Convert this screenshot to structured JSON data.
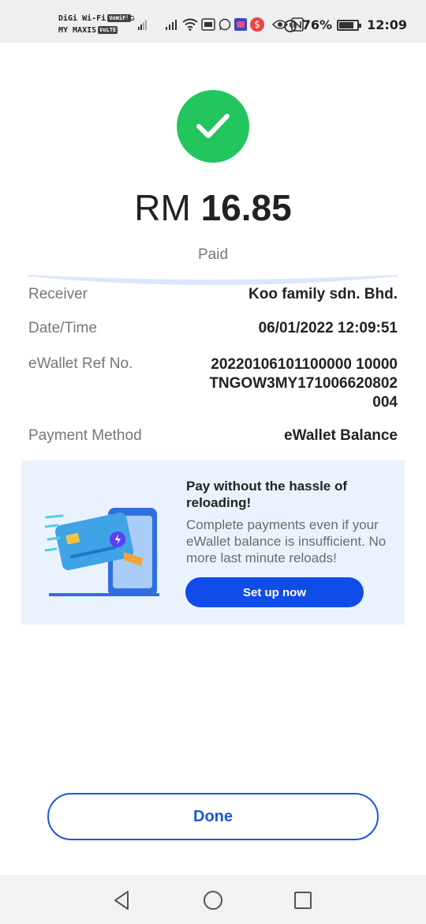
{
  "statusbar": {
    "carrier1": "DiGi Wi-Fi",
    "carrier1_tag": "VoWiFi",
    "carrier2": "MY MAXIS",
    "carrier2_tag": "VoLTE",
    "network": "4G",
    "battery_text": "76%",
    "battery_level": 0.76,
    "time": "12:09"
  },
  "payment": {
    "currency": "RM",
    "amount": "16.85",
    "status": "Paid"
  },
  "details": {
    "receiver_label": "Receiver",
    "receiver_value": "Koo family sdn. Bhd.",
    "datetime_label": "Date/Time",
    "datetime_value": "06/01/2022 12:09:51",
    "ref_label": "eWallet Ref No.",
    "ref_value": "20220106101100000 10000TNGOW3MY171006620802004",
    "method_label": "Payment Method",
    "method_value": "eWallet Balance"
  },
  "promo": {
    "title": "Pay without the hassle of reloading!",
    "description": "Complete payments even if your eWallet balance is insufficient. No more last minute reloads!",
    "button_label": "Set up now"
  },
  "actions": {
    "done_label": "Done"
  },
  "colors": {
    "success": "#22c55e",
    "primary": "#0f4ce8",
    "promo_bg": "#eaf3fd"
  }
}
